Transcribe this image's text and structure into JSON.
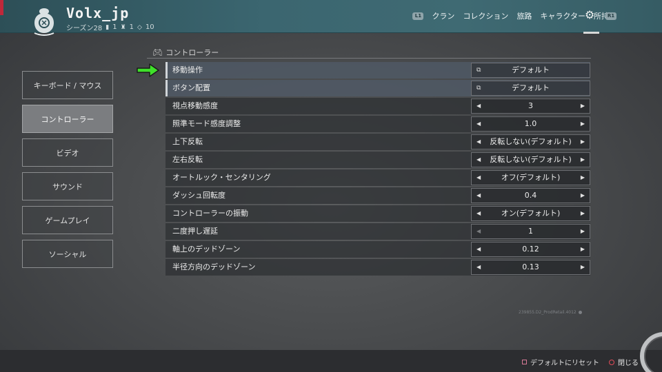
{
  "header": {
    "player_name": "Volx_jp",
    "season": "シーズン28",
    "stat1": "1",
    "stat2": "1",
    "stat3": "10"
  },
  "nav": {
    "l1_badge": "L1",
    "r1_badge": "R1",
    "items": [
      "クラン",
      "コレクション",
      "旅路",
      "キャラクター",
      "所持品"
    ]
  },
  "left_menu": {
    "items": [
      "キーボード / マウス",
      "コントローラー",
      "ビデオ",
      "サウンド",
      "ゲームプレイ",
      "ソーシャル"
    ],
    "active": "コントローラー"
  },
  "section": {
    "title": "コントローラー"
  },
  "settings": [
    {
      "label": "移動操作",
      "value": "デフォルト",
      "type": "link"
    },
    {
      "label": "ボタン配置",
      "value": "デフォルト",
      "type": "link"
    },
    {
      "label": "視点移動感度",
      "value": "3",
      "type": "stepper"
    },
    {
      "label": "照準モード感度調整",
      "value": "1.0",
      "type": "stepper"
    },
    {
      "label": "上下反転",
      "value": "反転しない(デフォルト)",
      "type": "stepper"
    },
    {
      "label": "左右反転",
      "value": "反転しない(デフォルト)",
      "type": "stepper"
    },
    {
      "label": "オートルック・センタリング",
      "value": "オフ(デフォルト)",
      "type": "stepper"
    },
    {
      "label": "ダッシュ回転度",
      "value": "0.4",
      "type": "stepper"
    },
    {
      "label": "コントローラーの振動",
      "value": "オン(デフォルト)",
      "type": "stepper"
    },
    {
      "label": "二度押し遅延",
      "value": "1",
      "type": "stepper",
      "left_disabled": true
    },
    {
      "label": "軸上のデッドゾーン",
      "value": "0.12",
      "type": "stepper"
    },
    {
      "label": "半径方向のデッドゾーン",
      "value": "0.13",
      "type": "stepper"
    }
  ],
  "build_info": "239855.D2_ProdRetail.4012",
  "footer": {
    "reset_label": "デフォルトにリセット",
    "close_label": "閉じる"
  },
  "colors": {
    "topbar": "#3b6670",
    "accent_arrow": "#3fe02a",
    "reset_icon": "#d97a98",
    "close_icon": "#e24b59"
  },
  "icons": {
    "emblem": "hunter-emblem-icon",
    "gear": "gear-icon",
    "controller": "gamepad-icon"
  }
}
